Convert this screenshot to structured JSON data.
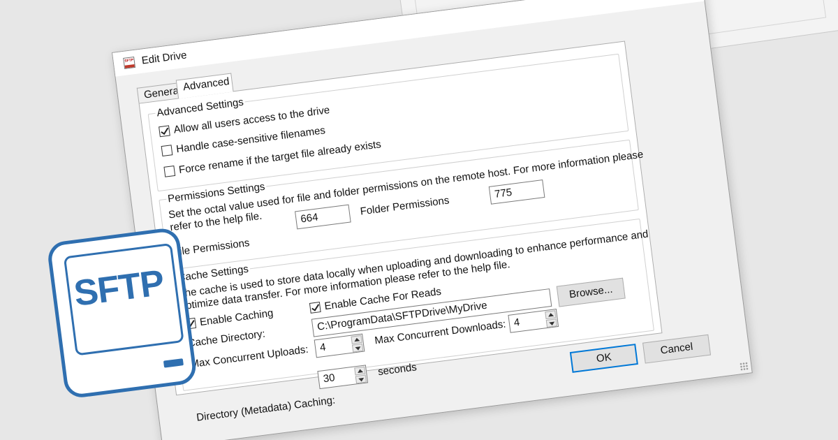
{
  "dialog": {
    "title": "Edit Drive",
    "icon_text": "SFTP",
    "tabs": [
      {
        "label": "General",
        "selected": false
      },
      {
        "label": "Advanced",
        "selected": true
      }
    ],
    "advanced": {
      "label": "Advanced Settings",
      "allow_all_users": {
        "label": "Allow all users access to the drive",
        "checked": true
      },
      "case_sensitive": {
        "label": "Handle case-sensitive filenames",
        "checked": false
      },
      "force_rename": {
        "label": "Force rename if the target file already exists",
        "checked": false
      }
    },
    "permissions": {
      "label": "Permissions Settings",
      "description_line1": "Set the octal value used for file and folder permissions on the remote host. For more information please",
      "description_line2": "refer to the help file.",
      "file_label": "File Permissions",
      "file_value": "664",
      "folder_label": "Folder Permissions",
      "folder_value": "775"
    },
    "cache": {
      "label": "Cache Settings",
      "description_line1": "The cache is used to store data locally when uploading and downloading to enhance performance and",
      "description_line2": "optimize data transfer. For more information please refer to the help file.",
      "enable_caching": {
        "label": "Enable Caching",
        "checked": true
      },
      "enable_reads": {
        "label": "Enable Cache For Reads",
        "checked": true
      },
      "directory_label": "Cache Directory:",
      "directory_value": "C:\\ProgramData\\SFTPDrive\\MyDrive",
      "browse_label": "Browse...",
      "uploads_label": "Max Concurrent Uploads:",
      "uploads_value": "4",
      "downloads_label": "Max Concurrent Downloads:",
      "downloads_value": "4",
      "metadata_label": "Directory (Metadata) Caching:",
      "metadata_value": "30",
      "metadata_unit": "seconds"
    },
    "ok_label": "OK",
    "cancel_label": "Cancel"
  },
  "logo": {
    "text": "SFTP"
  },
  "colors": {
    "brand_blue": "#2f6fb0",
    "focus_blue": "#0078d7"
  }
}
